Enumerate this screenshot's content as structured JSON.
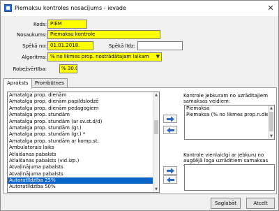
{
  "window": {
    "title": "Piemaksu kontroles nosacījums - ievade",
    "close_glyph": "✕"
  },
  "form": {
    "kods_label": "Kods:",
    "kods_value": "PIEM",
    "nosaukums_label": "Nosaukums:",
    "nosaukums_value": "Piemaksu kontrole",
    "speka_no_label": "Spēkā no:",
    "speka_no_value": "01.01.2018.",
    "speka_lidz_label": "Spēkā līdz:",
    "speka_lidz_value": "",
    "algoritms_label": "Algoritms:",
    "algoritms_value": "% no likmes prop. nostrādātajam laikam",
    "robezvertiba_label": "Robežvērtība:",
    "robezvertiba_value": "% 30.00"
  },
  "tabs": [
    {
      "label": "Apraksts"
    },
    {
      "label": "Prombūtnes"
    }
  ],
  "left_list": [
    "Amatalga prop. dienām",
    "Amatalga prop. dienām papildslodzē",
    "Amatalga prop. dienām pedagogiem",
    "Amatalga prop. stundām",
    "Amatalga prop. stundām (ar sv.st.d/d)",
    "Amatalga prop. stundām (gr.)",
    "Amatalga prop. stundām (gr.) *",
    "Amatalga prop. stundām ar komp.st.",
    "Ambulatorais laiks",
    "Atlaišanas pabalsts",
    "Atlaišanas pabalsts (vid.izp.)",
    "Atvaļinājuma pabalsts",
    "Atvaļinājuma  pabalsts",
    "Autoratlīdzība 25%",
    "Autoratlīdzība 50%"
  ],
  "left_list_selected_index": 13,
  "right_top": {
    "label": "Kontrole jebkuram no uzrādītajiem samaksas veidiem:",
    "items": [
      "Piemaksa",
      "Piemaksa (% no likmes prop.n.dienām)"
    ]
  },
  "right_bottom": {
    "label": "Kontrole vienlaicīgi ar jebkuru no augšējā loga uzrādītiem samaksas veidiem:",
    "items": []
  },
  "buttons": {
    "save": "Saglabāt",
    "cancel": "Atcelt"
  }
}
